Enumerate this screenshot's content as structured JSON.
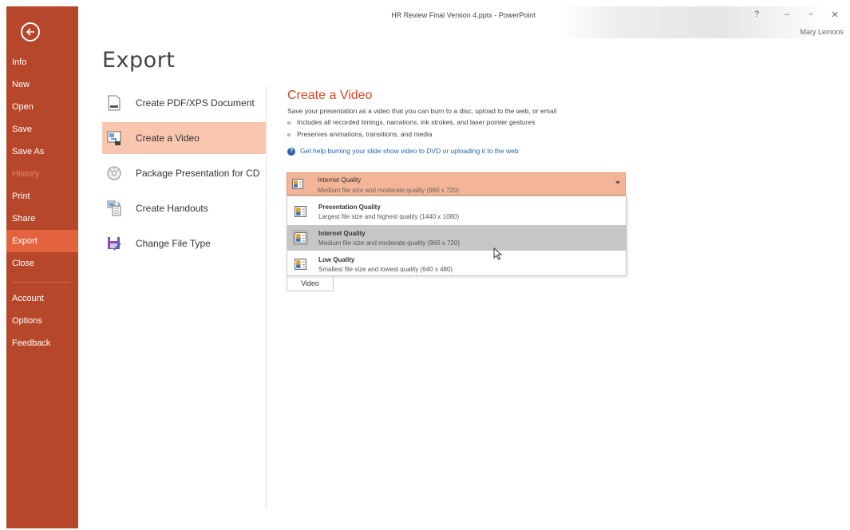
{
  "window": {
    "title": "HR Review Final Version 4.pptx - PowerPoint",
    "user": "Mary Lemons",
    "help_glyph": "?",
    "minimize_glyph": "–",
    "restore_glyph": "▫",
    "close_glyph": "✕"
  },
  "sidebar": {
    "back_icon": "back-arrow-icon",
    "items": [
      {
        "label": "Info",
        "state": "normal"
      },
      {
        "label": "New",
        "state": "normal"
      },
      {
        "label": "Open",
        "state": "normal"
      },
      {
        "label": "Save",
        "state": "normal"
      },
      {
        "label": "Save As",
        "state": "normal"
      },
      {
        "label": "History",
        "state": "disabled"
      },
      {
        "label": "Print",
        "state": "normal"
      },
      {
        "label": "Share",
        "state": "normal"
      },
      {
        "label": "Export",
        "state": "active"
      },
      {
        "label": "Close",
        "state": "normal"
      },
      {
        "label": "Account",
        "state": "normal"
      },
      {
        "label": "Options",
        "state": "normal"
      },
      {
        "label": "Feedback",
        "state": "normal"
      }
    ]
  },
  "page": {
    "title": "Export",
    "options": [
      {
        "label": "Create PDF/XPS Document",
        "icon": "pdf-document-icon"
      },
      {
        "label": "Create a Video",
        "icon": "video-icon",
        "active": true
      },
      {
        "label": "Package Presentation for CD",
        "icon": "cd-icon"
      },
      {
        "label": "Create Handouts",
        "icon": "handouts-icon"
      },
      {
        "label": "Change File Type",
        "icon": "change-file-type-icon"
      }
    ]
  },
  "detail": {
    "title": "Create a Video",
    "description": "Save your presentation as a video that you can burn to a disc, upload to the web, or email",
    "bullets": [
      "Includes all recorded timings, narrations, ink strokes, and laser pointer gestures",
      "Preserves animations, transitions, and media"
    ],
    "help_link": "Get help burning your slide show video to DVD or uploading it to the web",
    "quality_dropdown": {
      "selected_title": "Internet Quality",
      "selected_sub": "Medium file size and moderate quality (960 x 720)"
    },
    "quality_options": [
      {
        "title": "Presentation Quality",
        "sub": "Largest file size and highest quality (1440 x 1080)"
      },
      {
        "title": "Internet Quality",
        "sub": "Medium file size and moderate quality (960 x 720)",
        "hovered": true
      },
      {
        "title": "Low Quality",
        "sub": "Smallest file size and lowest quality (640 x 480)"
      }
    ],
    "create_video_button": "Video"
  },
  "colors": {
    "sidebar": "#b7472a",
    "sidebar_active": "#e3633f",
    "accent": "#d24726",
    "option_active": "#f9c6b0",
    "dropdown": "#f4b497",
    "link": "#2b64a8"
  }
}
